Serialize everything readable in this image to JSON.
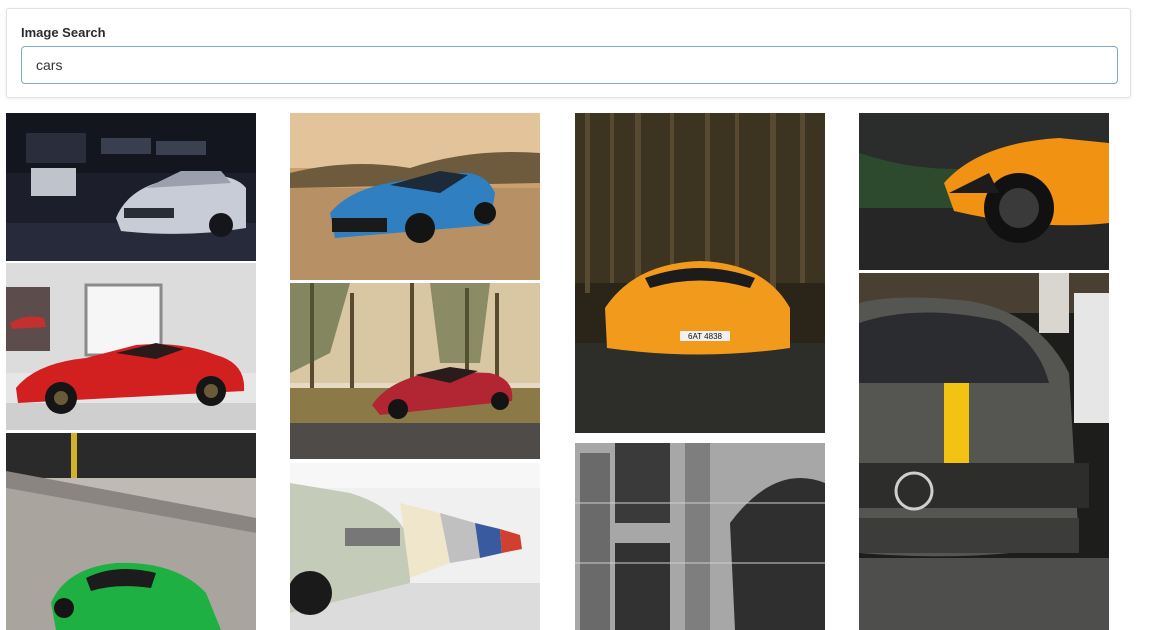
{
  "search": {
    "label": "Image Search",
    "value": "cars"
  },
  "gallery": {
    "images": [
      {
        "name": "silver-camaro-garage-photo",
        "plate": ""
      },
      {
        "name": "red-ferrari-showroom-photo",
        "plate": ""
      },
      {
        "name": "green-sports-car-photo",
        "plate": ""
      },
      {
        "name": "blue-camaro-desert-photo",
        "plate": ""
      },
      {
        "name": "red-mercedes-amg-forest-photo",
        "plate": ""
      },
      {
        "name": "classic-bmw-row-photo",
        "plate": ""
      },
      {
        "name": "orange-lamborghini-forest-photo",
        "plate": "6AT 4838"
      },
      {
        "name": "stone-building-facade-photo",
        "plate": ""
      },
      {
        "name": "orange-huracan-photo",
        "plate": ""
      },
      {
        "name": "grey-mercedes-amg-photo",
        "plate": ""
      }
    ]
  }
}
